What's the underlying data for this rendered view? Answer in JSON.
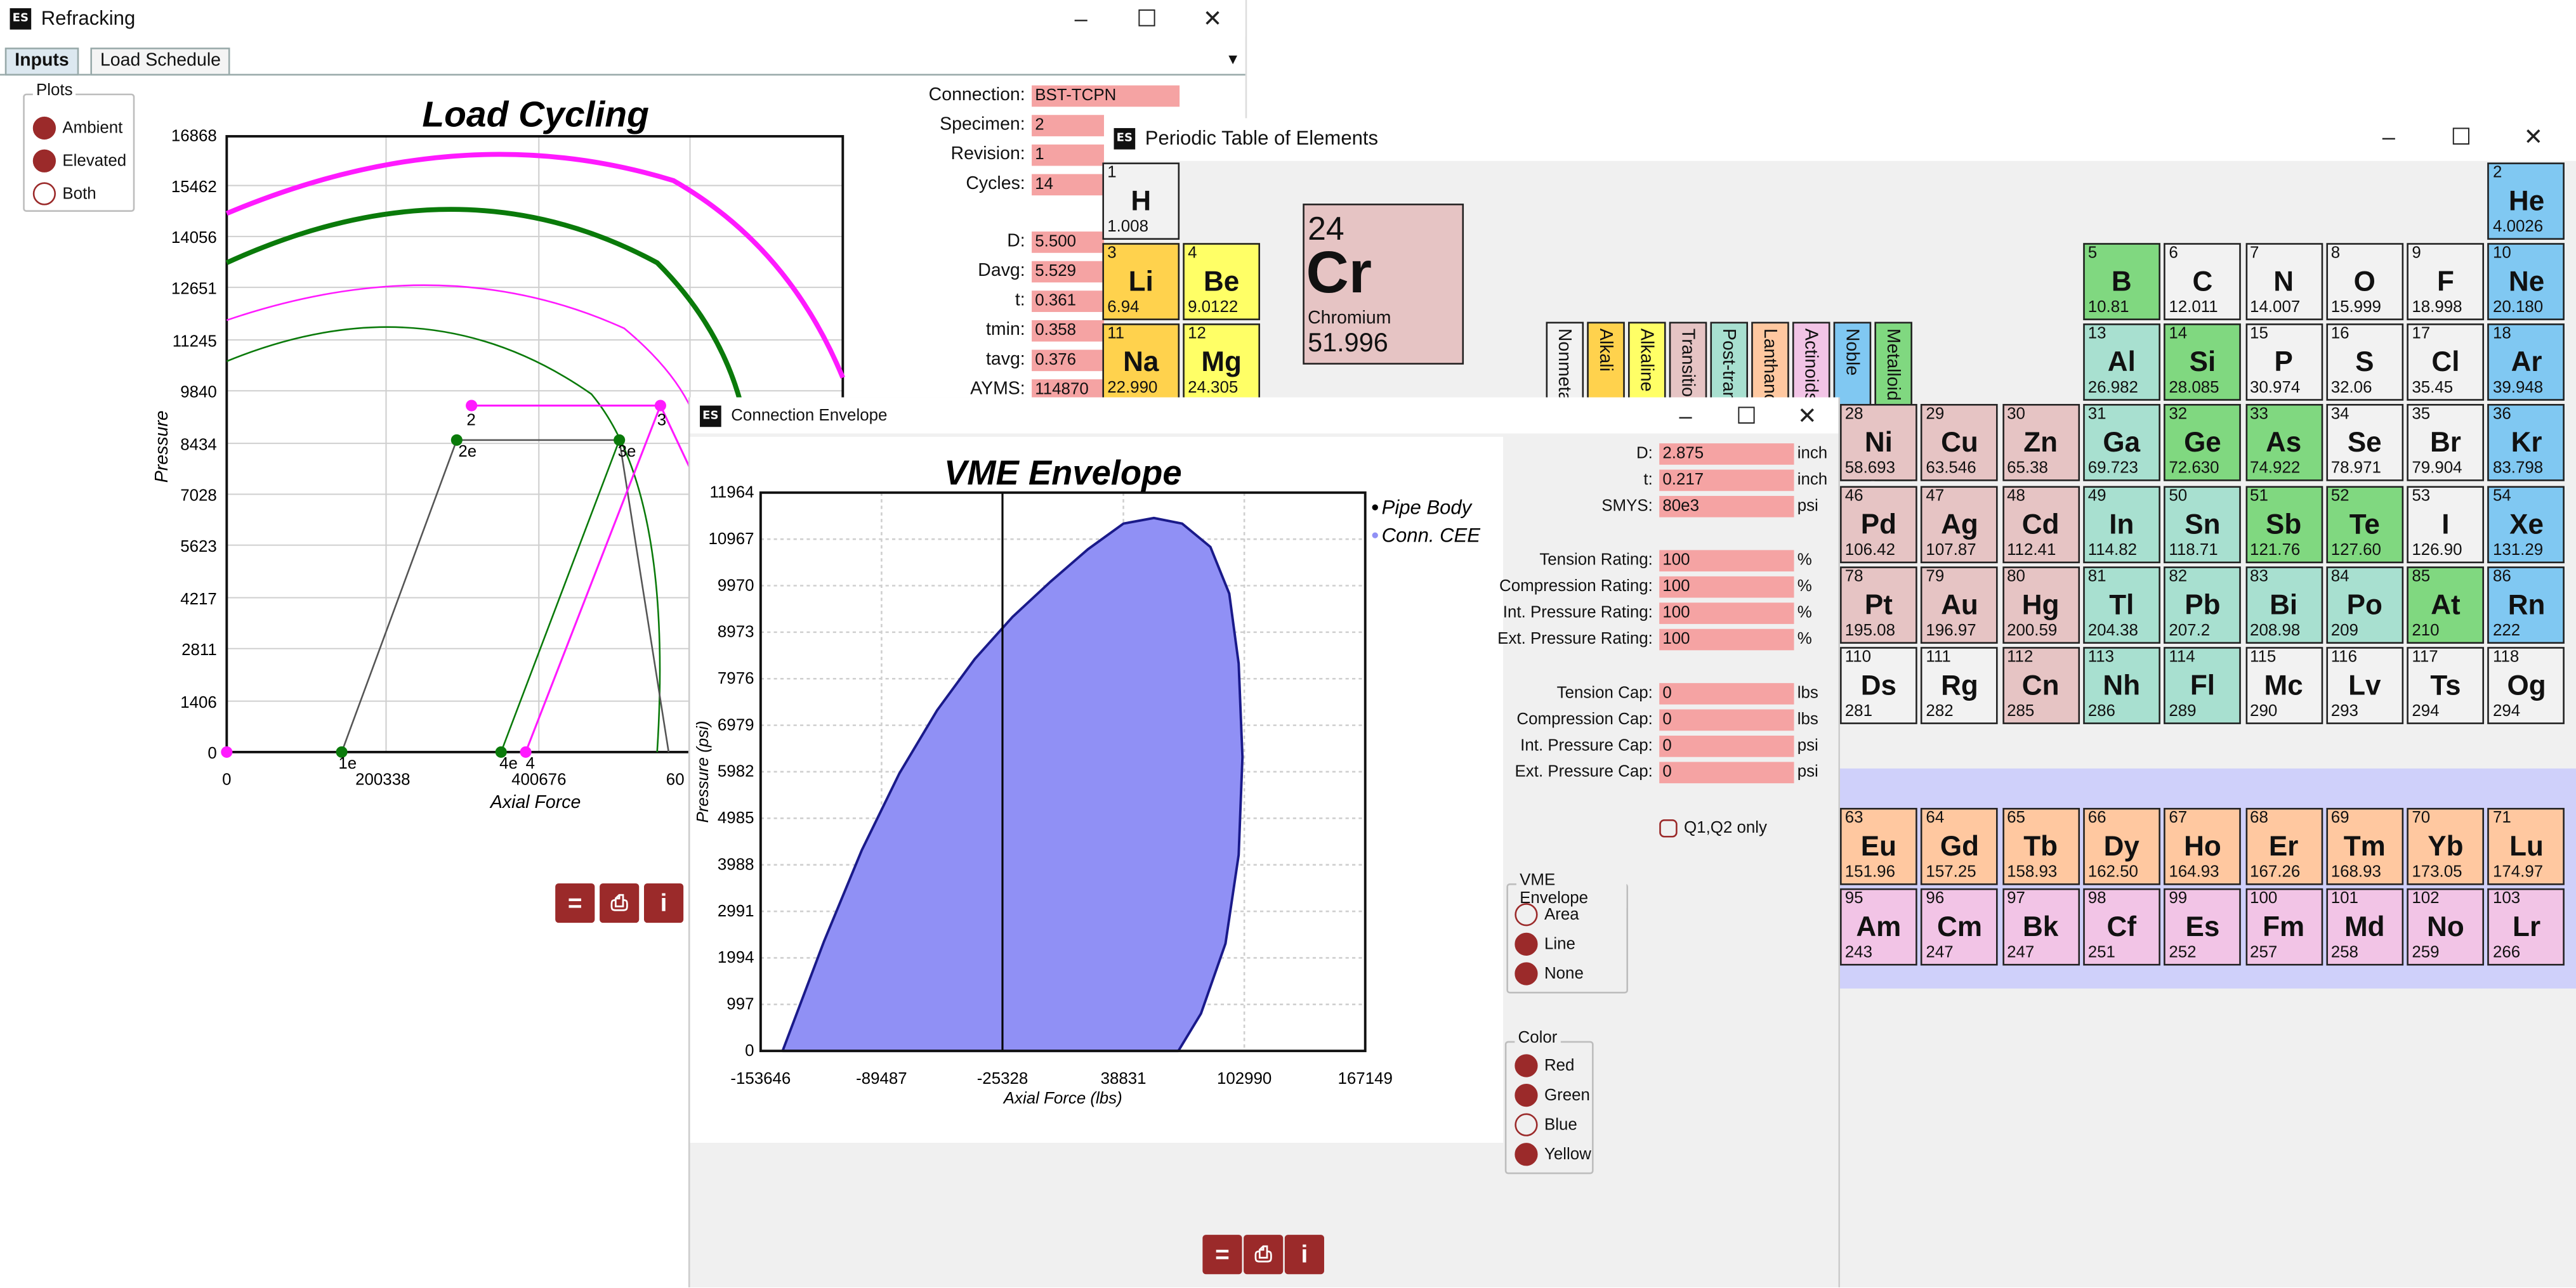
{
  "colors": {
    "field_bg": "#f5a3a3",
    "accent": "#9b2a2a",
    "magenta": "#ff1aff",
    "green": "#0a7a0a",
    "envelope_fill": "#9090f5",
    "envelope_stroke": "#1a1a8a",
    "cat_nonmetals": "#f2f2f2",
    "cat_alkali": "#ffd24d",
    "cat_alkaline": "#ffff66",
    "cat_transitional": "#e6c4c4",
    "cat_post": "#a8e0d0",
    "cat_lanth": "#ffc8a0",
    "cat_actinoids": "#f2c4e6",
    "cat_noble": "#80c8f2",
    "cat_metalloid": "#80d880"
  },
  "refracking": {
    "title": "Refracking",
    "tabs": [
      {
        "label": "Inputs"
      },
      {
        "label": "Load Schedule"
      }
    ],
    "plots_group": {
      "label": "Plots",
      "options": [
        {
          "label": "Ambient",
          "selected": true
        },
        {
          "label": "Elevated",
          "selected": true
        },
        {
          "label": "Both",
          "selected": false
        }
      ]
    },
    "fields": [
      {
        "label": "Connection:",
        "value": "BST-TCPN"
      },
      {
        "label": "Specimen:",
        "value": "2"
      },
      {
        "label": "Revision:",
        "value": "1"
      },
      {
        "label": "Cycles:",
        "value": "14"
      },
      {
        "label": "D:",
        "value": "5.500"
      },
      {
        "label": "Davg:",
        "value": "5.529"
      },
      {
        "label": "t:",
        "value": "0.361"
      },
      {
        "label": "tmin:",
        "value": "0.358"
      },
      {
        "label": "tavg:",
        "value": "0.376"
      },
      {
        "label": "AYMS:",
        "value": "114870"
      }
    ]
  },
  "load_chart": {
    "title": "Load Cycling",
    "xlabel": "Axial Force",
    "ylabel": "Pressure",
    "y_ticks": [
      "16868",
      "15462",
      "14056",
      "12651",
      "11245",
      "9840",
      "8434",
      "7028",
      "5623",
      "4217",
      "2811",
      "1406",
      "0"
    ],
    "x_ticks": [
      "0",
      "200338",
      "400676",
      "60"
    ],
    "point_labels": [
      "1e",
      "2e",
      "2",
      "3",
      "3e",
      "4e",
      "4"
    ]
  },
  "periodic": {
    "title": "Periodic Table of Elements",
    "selected": {
      "number": "24",
      "symbol": "Cr",
      "name": "Chromium",
      "mass": "51.996"
    },
    "categories": [
      {
        "label": "Nonmetals",
        "color_key": "cat_nonmetals"
      },
      {
        "label": "Alkali",
        "color_key": "cat_alkali"
      },
      {
        "label": "Alkaline",
        "color_key": "cat_alkaline"
      },
      {
        "label": "Transitional",
        "color_key": "cat_transitional"
      },
      {
        "label": "Post-transitional",
        "color_key": "cat_post"
      },
      {
        "label": "Lanthanoids",
        "color_key": "cat_lanth"
      },
      {
        "label": "Actinoids",
        "color_key": "cat_actinoids"
      },
      {
        "label": "Noble",
        "color_key": "cat_noble"
      },
      {
        "label": "Metalloid",
        "color_key": "cat_metalloid"
      }
    ],
    "elements": [
      {
        "n": "1",
        "s": "H",
        "m": "1.008",
        "c": "cat_nonmetals",
        "col": 1,
        "row": 1
      },
      {
        "n": "2",
        "s": "He",
        "m": "4.0026",
        "c": "cat_noble",
        "col": 18,
        "row": 1
      },
      {
        "n": "3",
        "s": "Li",
        "m": "6.94",
        "c": "cat_alkali",
        "col": 1,
        "row": 2
      },
      {
        "n": "4",
        "s": "Be",
        "m": "9.0122",
        "c": "cat_alkaline",
        "col": 2,
        "row": 2
      },
      {
        "n": "5",
        "s": "B",
        "m": "10.81",
        "c": "cat_metalloid",
        "col": 13,
        "row": 2
      },
      {
        "n": "6",
        "s": "C",
        "m": "12.011",
        "c": "cat_nonmetals",
        "col": 14,
        "row": 2
      },
      {
        "n": "7",
        "s": "N",
        "m": "14.007",
        "c": "cat_nonmetals",
        "col": 15,
        "row": 2
      },
      {
        "n": "8",
        "s": "O",
        "m": "15.999",
        "c": "cat_nonmetals",
        "col": 16,
        "row": 2
      },
      {
        "n": "9",
        "s": "F",
        "m": "18.998",
        "c": "cat_nonmetals",
        "col": 17,
        "row": 2
      },
      {
        "n": "10",
        "s": "Ne",
        "m": "20.180",
        "c": "cat_noble",
        "col": 18,
        "row": 2
      },
      {
        "n": "11",
        "s": "Na",
        "m": "22.990",
        "c": "cat_alkali",
        "col": 1,
        "row": 3
      },
      {
        "n": "12",
        "s": "Mg",
        "m": "24.305",
        "c": "cat_alkaline",
        "col": 2,
        "row": 3
      },
      {
        "n": "13",
        "s": "Al",
        "m": "26.982",
        "c": "cat_post",
        "col": 13,
        "row": 3
      },
      {
        "n": "14",
        "s": "Si",
        "m": "28.085",
        "c": "cat_metalloid",
        "col": 14,
        "row": 3
      },
      {
        "n": "15",
        "s": "P",
        "m": "30.974",
        "c": "cat_nonmetals",
        "col": 15,
        "row": 3
      },
      {
        "n": "16",
        "s": "S",
        "m": "32.06",
        "c": "cat_nonmetals",
        "col": 16,
        "row": 3
      },
      {
        "n": "17",
        "s": "Cl",
        "m": "35.45",
        "c": "cat_nonmetals",
        "col": 17,
        "row": 3
      },
      {
        "n": "18",
        "s": "Ar",
        "m": "39.948",
        "c": "cat_noble",
        "col": 18,
        "row": 3
      },
      {
        "n": "28",
        "s": "Ni",
        "m": "58.693",
        "c": "cat_transitional",
        "col": 10,
        "row": 4
      },
      {
        "n": "29",
        "s": "Cu",
        "m": "63.546",
        "c": "cat_transitional",
        "col": 11,
        "row": 4
      },
      {
        "n": "30",
        "s": "Zn",
        "m": "65.38",
        "c": "cat_transitional",
        "col": 12,
        "row": 4
      },
      {
        "n": "31",
        "s": "Ga",
        "m": "69.723",
        "c": "cat_post",
        "col": 13,
        "row": 4
      },
      {
        "n": "32",
        "s": "Ge",
        "m": "72.630",
        "c": "cat_metalloid",
        "col": 14,
        "row": 4
      },
      {
        "n": "33",
        "s": "As",
        "m": "74.922",
        "c": "cat_metalloid",
        "col": 15,
        "row": 4
      },
      {
        "n": "34",
        "s": "Se",
        "m": "78.971",
        "c": "cat_nonmetals",
        "col": 16,
        "row": 4
      },
      {
        "n": "35",
        "s": "Br",
        "m": "79.904",
        "c": "cat_nonmetals",
        "col": 17,
        "row": 4
      },
      {
        "n": "36",
        "s": "Kr",
        "m": "83.798",
        "c": "cat_noble",
        "col": 18,
        "row": 4
      },
      {
        "n": "46",
        "s": "Pd",
        "m": "106.42",
        "c": "cat_transitional",
        "col": 10,
        "row": 5
      },
      {
        "n": "47",
        "s": "Ag",
        "m": "107.87",
        "c": "cat_transitional",
        "col": 11,
        "row": 5
      },
      {
        "n": "48",
        "s": "Cd",
        "m": "112.41",
        "c": "cat_transitional",
        "col": 12,
        "row": 5
      },
      {
        "n": "49",
        "s": "In",
        "m": "114.82",
        "c": "cat_post",
        "col": 13,
        "row": 5
      },
      {
        "n": "50",
        "s": "Sn",
        "m": "118.71",
        "c": "cat_post",
        "col": 14,
        "row": 5
      },
      {
        "n": "51",
        "s": "Sb",
        "m": "121.76",
        "c": "cat_metalloid",
        "col": 15,
        "row": 5
      },
      {
        "n": "52",
        "s": "Te",
        "m": "127.60",
        "c": "cat_metalloid",
        "col": 16,
        "row": 5
      },
      {
        "n": "53",
        "s": "I",
        "m": "126.90",
        "c": "cat_nonmetals",
        "col": 17,
        "row": 5
      },
      {
        "n": "54",
        "s": "Xe",
        "m": "131.29",
        "c": "cat_noble",
        "col": 18,
        "row": 5
      },
      {
        "n": "78",
        "s": "Pt",
        "m": "195.08",
        "c": "cat_transitional",
        "col": 10,
        "row": 6
      },
      {
        "n": "79",
        "s": "Au",
        "m": "196.97",
        "c": "cat_transitional",
        "col": 11,
        "row": 6
      },
      {
        "n": "80",
        "s": "Hg",
        "m": "200.59",
        "c": "cat_transitional",
        "col": 12,
        "row": 6
      },
      {
        "n": "81",
        "s": "Tl",
        "m": "204.38",
        "c": "cat_post",
        "col": 13,
        "row": 6
      },
      {
        "n": "82",
        "s": "Pb",
        "m": "207.2",
        "c": "cat_post",
        "col": 14,
        "row": 6
      },
      {
        "n": "83",
        "s": "Bi",
        "m": "208.98",
        "c": "cat_post",
        "col": 15,
        "row": 6
      },
      {
        "n": "84",
        "s": "Po",
        "m": "209",
        "c": "cat_post",
        "col": 16,
        "row": 6
      },
      {
        "n": "85",
        "s": "At",
        "m": "210",
        "c": "cat_metalloid",
        "col": 17,
        "row": 6
      },
      {
        "n": "86",
        "s": "Rn",
        "m": "222",
        "c": "cat_noble",
        "col": 18,
        "row": 6
      },
      {
        "n": "110",
        "s": "Ds",
        "m": "281",
        "c": "cat_nonmetals",
        "col": 10,
        "row": 7
      },
      {
        "n": "111",
        "s": "Rg",
        "m": "282",
        "c": "cat_nonmetals",
        "col": 11,
        "row": 7
      },
      {
        "n": "112",
        "s": "Cn",
        "m": "285",
        "c": "cat_transitional",
        "col": 12,
        "row": 7
      },
      {
        "n": "113",
        "s": "Nh",
        "m": "286",
        "c": "cat_post",
        "col": 13,
        "row": 7
      },
      {
        "n": "114",
        "s": "Fl",
        "m": "289",
        "c": "cat_post",
        "col": 14,
        "row": 7
      },
      {
        "n": "115",
        "s": "Mc",
        "m": "290",
        "c": "cat_nonmetals",
        "col": 15,
        "row": 7
      },
      {
        "n": "116",
        "s": "Lv",
        "m": "293",
        "c": "cat_nonmetals",
        "col": 16,
        "row": 7
      },
      {
        "n": "117",
        "s": "Ts",
        "m": "294",
        "c": "cat_nonmetals",
        "col": 17,
        "row": 7
      },
      {
        "n": "118",
        "s": "Og",
        "m": "294",
        "c": "cat_nonmetals",
        "col": 18,
        "row": 7
      },
      {
        "n": "63",
        "s": "Eu",
        "m": "151.96",
        "c": "cat_lanth",
        "col": 10,
        "row": 9
      },
      {
        "n": "64",
        "s": "Gd",
        "m": "157.25",
        "c": "cat_lanth",
        "col": 11,
        "row": 9
      },
      {
        "n": "65",
        "s": "Tb",
        "m": "158.93",
        "c": "cat_lanth",
        "col": 12,
        "row": 9
      },
      {
        "n": "66",
        "s": "Dy",
        "m": "162.50",
        "c": "cat_lanth",
        "col": 13,
        "row": 9
      },
      {
        "n": "67",
        "s": "Ho",
        "m": "164.93",
        "c": "cat_lanth",
        "col": 14,
        "row": 9
      },
      {
        "n": "68",
        "s": "Er",
        "m": "167.26",
        "c": "cat_lanth",
        "col": 15,
        "row": 9
      },
      {
        "n": "69",
        "s": "Tm",
        "m": "168.93",
        "c": "cat_lanth",
        "col": 16,
        "row": 9
      },
      {
        "n": "70",
        "s": "Yb",
        "m": "173.05",
        "c": "cat_lanth",
        "col": 17,
        "row": 9
      },
      {
        "n": "71",
        "s": "Lu",
        "m": "174.97",
        "c": "cat_lanth",
        "col": 18,
        "row": 9
      },
      {
        "n": "95",
        "s": "Am",
        "m": "243",
        "c": "cat_actinoids",
        "col": 10,
        "row": 10
      },
      {
        "n": "96",
        "s": "Cm",
        "m": "247",
        "c": "cat_actinoids",
        "col": 11,
        "row": 10
      },
      {
        "n": "97",
        "s": "Bk",
        "m": "247",
        "c": "cat_actinoids",
        "col": 12,
        "row": 10
      },
      {
        "n": "98",
        "s": "Cf",
        "m": "251",
        "c": "cat_actinoids",
        "col": 13,
        "row": 10
      },
      {
        "n": "99",
        "s": "Es",
        "m": "252",
        "c": "cat_actinoids",
        "col": 14,
        "row": 10
      },
      {
        "n": "100",
        "s": "Fm",
        "m": "257",
        "c": "cat_actinoids",
        "col": 15,
        "row": 10
      },
      {
        "n": "101",
        "s": "Md",
        "m": "258",
        "c": "cat_actinoids",
        "col": 16,
        "row": 10
      },
      {
        "n": "102",
        "s": "No",
        "m": "259",
        "c": "cat_actinoids",
        "col": 17,
        "row": 10
      },
      {
        "n": "103",
        "s": "Lr",
        "m": "266",
        "c": "cat_actinoids",
        "col": 18,
        "row": 10
      }
    ]
  },
  "envelope": {
    "title": "Connection Envelope",
    "fields": [
      {
        "label": "D:",
        "value": "2.875",
        "unit": "inch"
      },
      {
        "label": "t:",
        "value": "0.217",
        "unit": "inch"
      },
      {
        "label": "SMYS:",
        "value": "80e3",
        "unit": "psi"
      },
      {
        "label": "Tension Rating:",
        "value": "100",
        "unit": "%"
      },
      {
        "label": "Compression Rating:",
        "value": "100",
        "unit": "%"
      },
      {
        "label": "Int. Pressure Rating:",
        "value": "100",
        "unit": "%"
      },
      {
        "label": "Ext. Pressure Rating:",
        "value": "100",
        "unit": "%"
      },
      {
        "label": "Tension Cap:",
        "value": "0",
        "unit": "lbs"
      },
      {
        "label": "Compression Cap:",
        "value": "0",
        "unit": "lbs"
      },
      {
        "label": "Int. Pressure Cap:",
        "value": "0",
        "unit": "psi"
      },
      {
        "label": "Ext. Pressure Cap:",
        "value": "0",
        "unit": "psi"
      }
    ],
    "q1q2_label": "Q1,Q2 only",
    "vme_group": {
      "label": "VME Envelope",
      "options": [
        {
          "label": "Area",
          "selected": false
        },
        {
          "label": "Line",
          "selected": true
        },
        {
          "label": "None",
          "selected": true
        }
      ]
    },
    "color_group": {
      "label": "Color",
      "options": [
        {
          "label": "Red",
          "selected": true
        },
        {
          "label": "Green",
          "selected": true
        },
        {
          "label": "Blue",
          "selected": false
        },
        {
          "label": "Yellow",
          "selected": true
        }
      ]
    }
  },
  "chart_data": [
    {
      "type": "line",
      "title": "VME Envelope",
      "xlabel": "Axial Force (lbs)",
      "ylabel": "Pressure (psi)",
      "xlim": [
        -153646,
        167149
      ],
      "ylim": [
        0,
        11964
      ],
      "x_ticks": [
        "-153646",
        "-89487",
        "-25328",
        "38831",
        "102990",
        "167149"
      ],
      "y_ticks": [
        "11964",
        "10967",
        "9970",
        "8973",
        "7976",
        "6979",
        "5982",
        "4985",
        "3988",
        "2991",
        "1994",
        "997",
        "0"
      ],
      "legend": [
        "Pipe Body",
        "Conn. CEE"
      ],
      "legend_position": "right",
      "series": [
        {
          "name": "Pipe Body",
          "x": [
            -142000,
            -120000,
            -100000,
            -80000,
            -60000,
            -40000,
            -20000,
            0,
            20000,
            38831,
            55000,
            70000,
            85000,
            95000,
            100000,
            102000,
            100000,
            93000,
            80000,
            68000
          ],
          "y": [
            0,
            2350,
            4300,
            5950,
            7300,
            8400,
            9300,
            10050,
            10750,
            11300,
            11420,
            11300,
            10800,
            9800,
            8300,
            6300,
            4200,
            2300,
            800,
            0
          ]
        }
      ],
      "vertical_line_x": -25328
    },
    {
      "type": "line",
      "title": "Load Cycling",
      "xlabel": "Axial Force",
      "ylabel": "Pressure",
      "ylim": [
        0,
        16868
      ],
      "x_ticks": [
        "0",
        "200338",
        "400676",
        "60"
      ]
    }
  ]
}
